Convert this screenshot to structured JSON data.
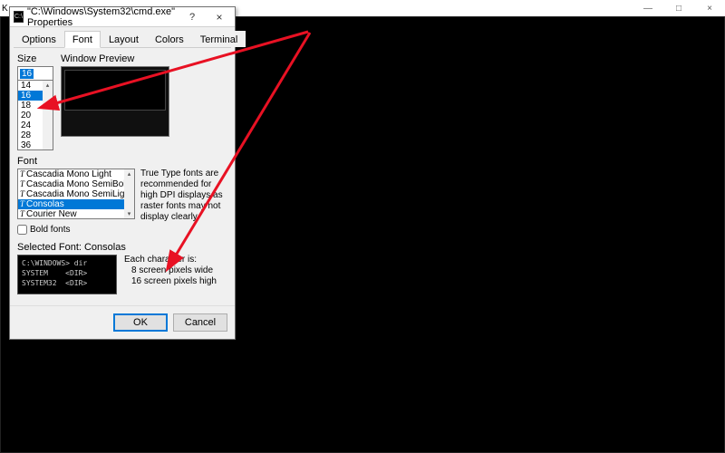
{
  "host": {
    "title_marker": "K",
    "min": "—",
    "max": "□",
    "close": "×"
  },
  "dialog": {
    "title": "\"C:\\Windows\\System32\\cmd.exe\" Properties",
    "help": "?",
    "close": "×",
    "tabs": {
      "options": "Options",
      "font": "Font",
      "layout": "Layout",
      "colors": "Colors",
      "terminal": "Terminal"
    },
    "size": {
      "label": "Size",
      "current": "16",
      "options": [
        "14",
        "16",
        "18",
        "20",
        "24",
        "28",
        "36"
      ]
    },
    "preview_label": "Window Preview",
    "font": {
      "label": "Font",
      "options": [
        "Cascadia Mono Light",
        "Cascadia Mono SemiBold",
        "Cascadia Mono SemiLight",
        "Consolas",
        "Courier New"
      ],
      "selected_index": 3,
      "desc": "True Type fonts are recommended for high DPI displays as raster fonts may not display clearly.",
      "bold_label": "Bold fonts"
    },
    "selected": {
      "label": "Selected Font: Consolas",
      "sample": "C:\\WINDOWS> dir\nSYSTEM    <DIR>\nSYSTEM32  <DIR>",
      "char_header": "Each character is:",
      "char_w": "8 screen pixels wide",
      "char_h": "16 screen pixels high"
    },
    "buttons": {
      "ok": "OK",
      "cancel": "Cancel"
    }
  }
}
